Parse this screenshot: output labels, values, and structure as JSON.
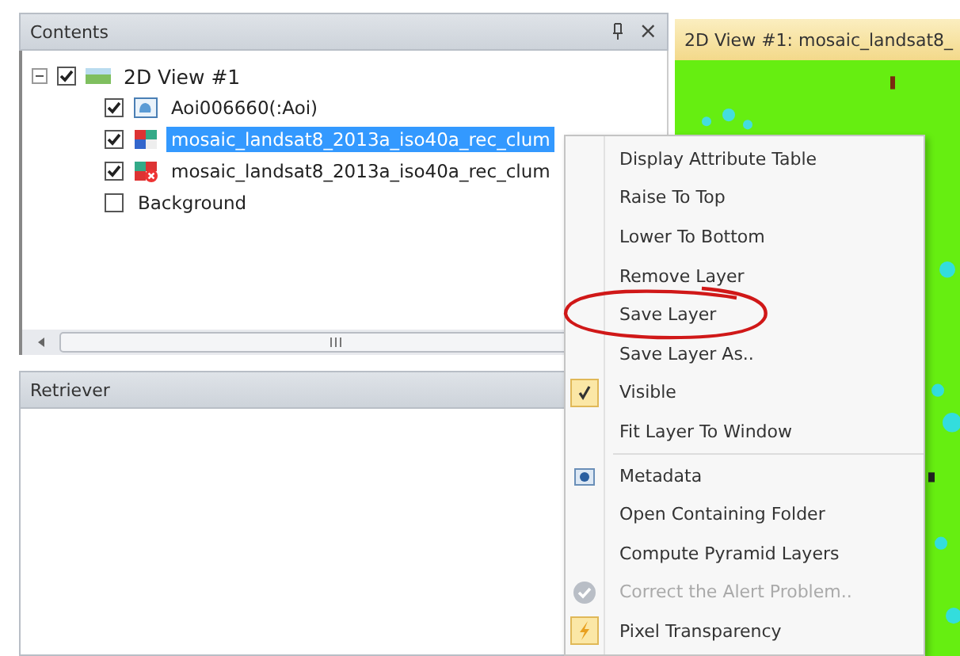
{
  "contents_panel": {
    "title": "Contents",
    "close": "×",
    "tree": [
      {
        "label": "2D View #1",
        "checked": true,
        "expanded": true,
        "selected": false,
        "kind": "view",
        "children": [
          {
            "label": "Aoi006660(:Aoi)",
            "checked": true,
            "selected": false,
            "kind": "shape"
          },
          {
            "label": "mosaic_landsat8_2013a_iso40a_rec_clum",
            "checked": true,
            "selected": true,
            "kind": "raster"
          },
          {
            "label": "mosaic_landsat8_2013a_iso40a_rec_clum",
            "checked": true,
            "selected": false,
            "kind": "error"
          },
          {
            "label": "Background",
            "checked": false,
            "selected": false,
            "kind": "plain"
          }
        ]
      }
    ]
  },
  "retriever_panel": {
    "title": "Retriever"
  },
  "view_tab": {
    "title": "2D View #1: mosaic_landsat8_"
  },
  "context_menu": {
    "items": [
      {
        "kind": "plain",
        "label": "Display Attribute Table",
        "checked": false,
        "disabled": false,
        "circled": false
      },
      {
        "kind": "plain",
        "label": "Raise To Top",
        "checked": false,
        "disabled": false,
        "circled": false
      },
      {
        "kind": "plain",
        "label": "Lower To Bottom",
        "checked": false,
        "disabled": false,
        "circled": false
      },
      {
        "kind": "plain",
        "label": "Remove Layer",
        "checked": false,
        "disabled": false,
        "circled": false
      },
      {
        "kind": "plain",
        "label": "Save Layer",
        "checked": false,
        "disabled": false,
        "circled": true
      },
      {
        "kind": "plain",
        "label": "Save Layer As..",
        "checked": false,
        "disabled": false,
        "circled": false
      },
      {
        "kind": "plain",
        "label": "Visible",
        "checked": true,
        "disabled": false,
        "circled": false
      },
      {
        "kind": "plain",
        "label": "Fit Layer To Window",
        "checked": false,
        "disabled": false,
        "circled": false
      },
      {
        "kind": "separator"
      },
      {
        "kind": "info",
        "label": "Metadata",
        "checked": false,
        "disabled": false,
        "circled": false
      },
      {
        "kind": "plain",
        "label": "Open Containing Folder",
        "checked": false,
        "disabled": false,
        "circled": false
      },
      {
        "kind": "plain",
        "label": "Compute Pyramid Layers",
        "checked": false,
        "disabled": false,
        "circled": false
      },
      {
        "kind": "alert",
        "label": "Correct the Alert Problem..",
        "checked": false,
        "disabled": true,
        "circled": false
      },
      {
        "kind": "tool",
        "label": "Pixel Transparency",
        "checked": false,
        "disabled": false,
        "circled": false
      }
    ]
  }
}
